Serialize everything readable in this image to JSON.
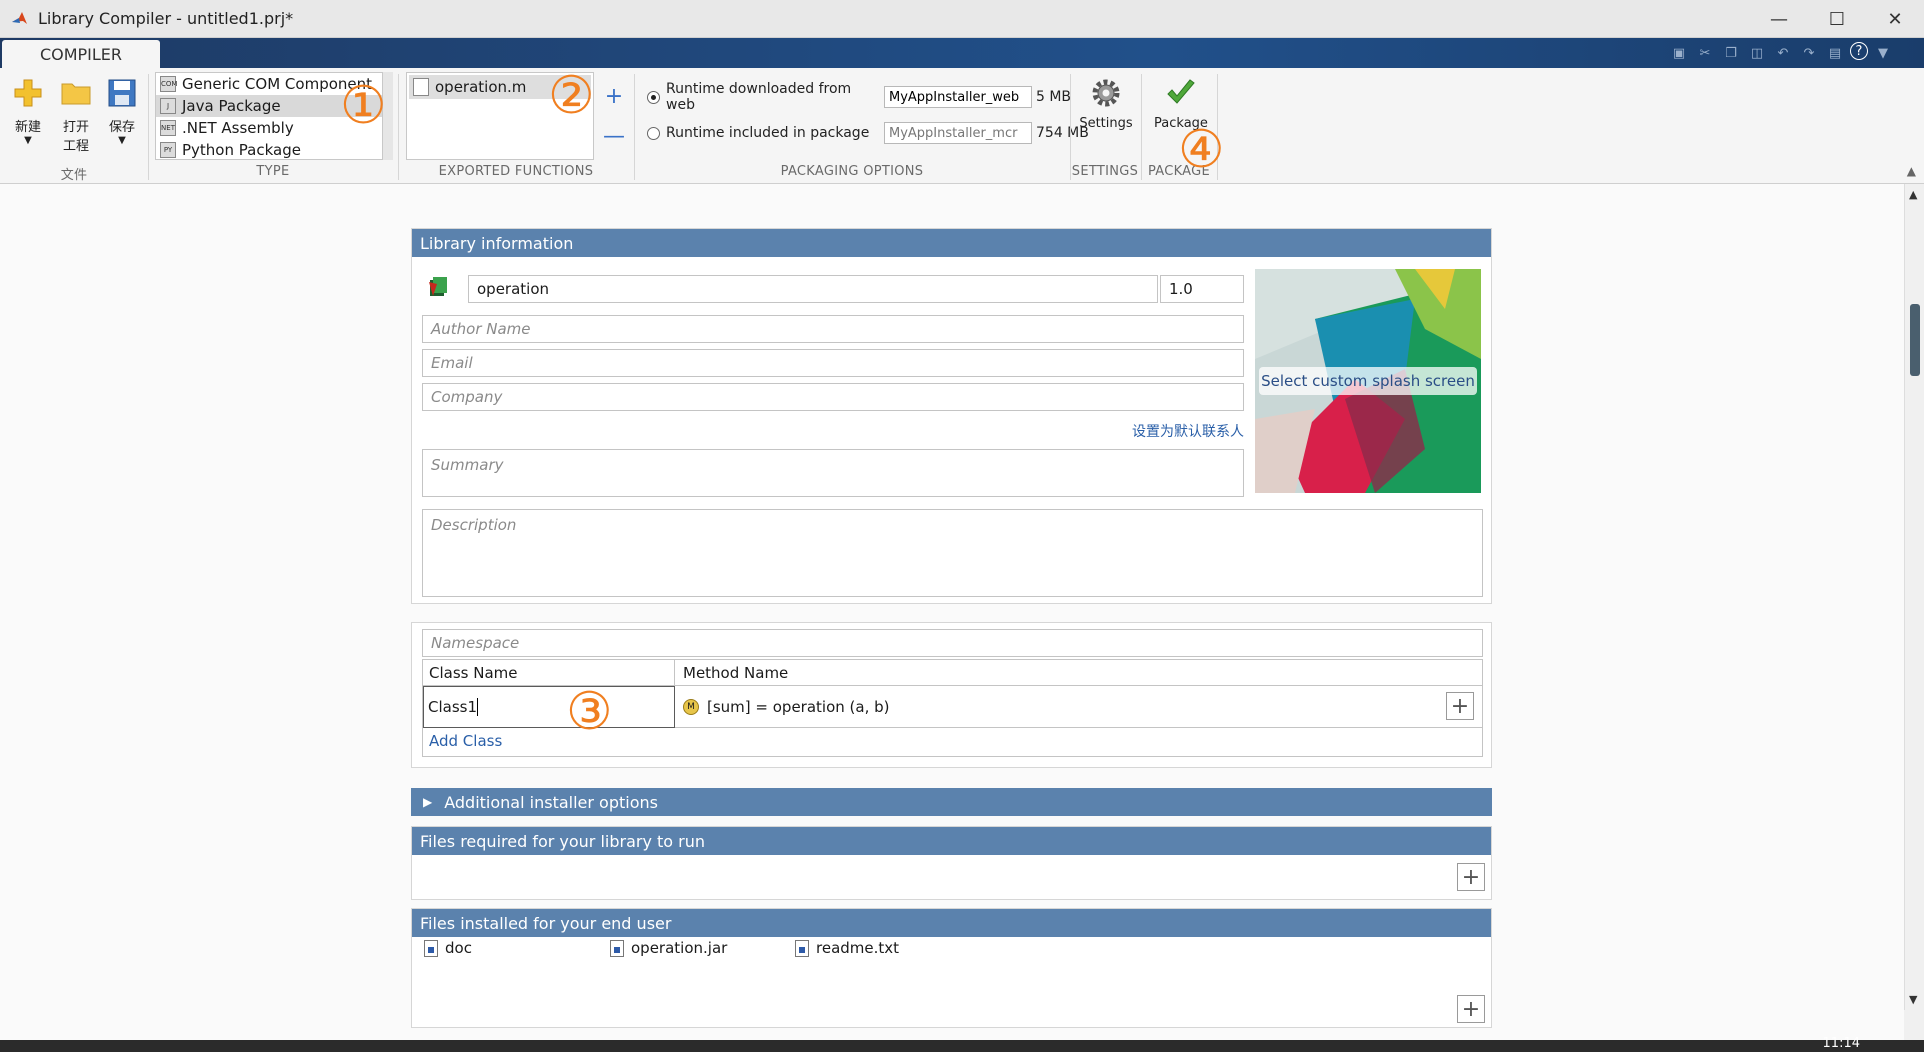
{
  "window": {
    "title": "Library Compiler - untitled1.prj*",
    "controls": [
      "minimize-icon",
      "maximize-icon",
      "close-icon"
    ]
  },
  "tabs": {
    "compiler": "COMPILER"
  },
  "ribbon": {
    "file_group": {
      "label": "文件",
      "new_label": "新建",
      "open_label_1": "打开",
      "open_label_2": "工程",
      "save_label": "保存"
    },
    "type_group": {
      "label": "TYPE",
      "items": [
        "Generic COM Component",
        "Java Package",
        ".NET Assembly",
        "Python Package"
      ],
      "selected": "Java Package"
    },
    "exported_functions": {
      "label": "EXPORTED FUNCTIONS",
      "items": [
        "operation.m"
      ]
    },
    "packaging_options": {
      "label": "PACKAGING OPTIONS",
      "web_label": "Runtime downloaded from web",
      "web_value": "MyAppInstaller_web",
      "web_size": "5 MB",
      "included_label": "Runtime included in package",
      "included_value": "MyAppInstaller_mcr",
      "included_size": "754 MB"
    },
    "settings": {
      "label": "SETTINGS",
      "button": "Settings"
    },
    "package": {
      "label": "PACKAGE",
      "button": "Package"
    }
  },
  "library_information": {
    "header": "Library information",
    "name": "operation",
    "version": "1.0",
    "author_placeholder": "Author Name",
    "email_placeholder": "Email",
    "company_placeholder": "Company",
    "default_contact_link": "设置为默认联系人",
    "summary_placeholder": "Summary",
    "description_placeholder": "Description",
    "splash_button": "Select custom splash screen"
  },
  "class_section": {
    "namespace_placeholder": "Namespace",
    "col_class": "Class Name",
    "col_method": "Method Name",
    "class_value": "Class1",
    "method_value": "[sum] = operation (a, b)",
    "add_class": "Add Class"
  },
  "additional_installer": {
    "header": "Additional installer options"
  },
  "files_required": {
    "header": "Files required for your library to run"
  },
  "files_installed": {
    "header": "Files installed for your end user",
    "files": [
      "doc",
      "operation.jar",
      "readme.txt"
    ]
  },
  "annotations": [
    "①",
    "②",
    "③",
    "④"
  ],
  "taskbar": {
    "clock": "11:14"
  }
}
